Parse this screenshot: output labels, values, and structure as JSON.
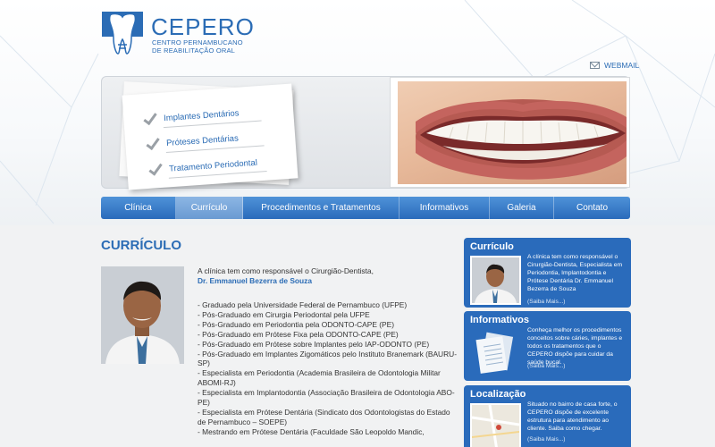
{
  "logo": {
    "title": "CEPERO",
    "subtitle_line1": "CENTRO PERNAMBUCANO",
    "subtitle_line2": "DE REABILITAÇÃO ORAL"
  },
  "webmail": {
    "label": "WEBMAIL",
    "icon": "mail-icon"
  },
  "banner": {
    "items": [
      "Implantes Dentários",
      "Próteses Dentárias",
      "Tratamento Periodontal"
    ]
  },
  "nav": {
    "items": [
      {
        "label": "Clínica",
        "active": false
      },
      {
        "label": "Currículo",
        "active": true
      },
      {
        "label": "Procedimentos e Tratamentos",
        "active": false
      },
      {
        "label": "Informativos",
        "active": false
      },
      {
        "label": "Galeria",
        "active": false
      },
      {
        "label": "Contato",
        "active": false
      }
    ]
  },
  "content": {
    "title": "CURRÍCULO",
    "intro": "A clínica tem como responsável o Cirurgião-Dentista,",
    "doctor_name": "Dr. Emmanuel Bezerra de Souza",
    "cv_items": [
      "- Graduado pela Universidade Federal de Pernambuco (UFPE)",
      "- Pós-Graduado em Cirurgia Periodontal pela UFPE",
      "- Pós-Graduado em Periodontia pela ODONTO-CAPE (PE)",
      "- Pós-Graduado em Prótese Fixa pela ODONTO-CAPE (PE)",
      "- Pós-Graduado em Prótese sobre Implantes pelo IAP-ODONTO (PE)",
      "- Pós-Graduado em Implantes Zigomáticos pelo Instituto Branemark (BAURU-SP)",
      "- Especialista em Periodontia (Academia Brasileira de Odontologia Militar ABOMI-RJ)",
      "- Especialista em Implantodontia (Associação Brasileira de Odontologia ABO-PE)",
      "- Especialista em Prótese Dentária (Sindicato dos Odontologistas do Estado de Pernambuco – SOEPE)",
      "- Mestrando em Prótese Dentária (Faculdade São Leopoldo Mandic,"
    ]
  },
  "sidebar": {
    "curriculo": {
      "title": "Currículo",
      "text": "A clínica tem como responsável o Cirurgião-Dentista, Especialista em Periodontia, Implantodontia e Prótese Dentária Dr. Emmanuel Bezerra de Souza",
      "more": "(Saiba Mais...)"
    },
    "informativos": {
      "title": "Informativos",
      "text": "Conheça melhor os procedimentos conceitos sobre cáries, implantes e todos os tratamentos que o CEPERO dispõe para cuidar da saúde bucal.",
      "more": "(Saiba Mais...)"
    },
    "localizacao": {
      "title": "Localização",
      "text": "Situado no bairro de casa forte, o CEPERO dispõe de excelente estrutura para atendimento ao cliente. Saiba como chegar.",
      "more": "(Saiba Mais...)"
    }
  },
  "colors": {
    "brand_blue": "#2b6cb5",
    "nav_blue": "#2a6bbb",
    "active_tab": "#7aa8dc"
  }
}
